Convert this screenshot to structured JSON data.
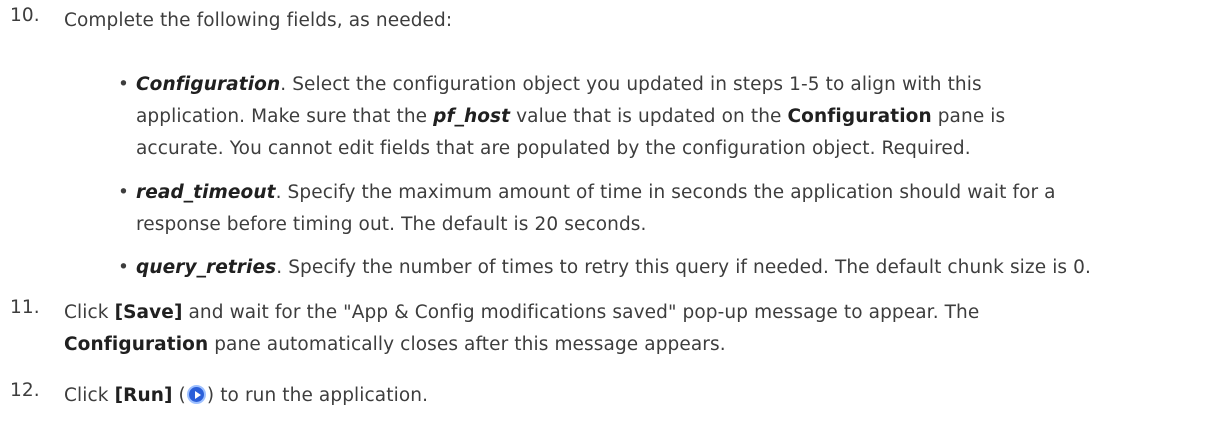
{
  "step10": {
    "number": "10.",
    "intro": "Complete the following fields, as needed:",
    "bullets": [
      {
        "term": "Configuration",
        "t1": ". Select the configuration object you updated in steps 1-5 to align with this",
        "t2": "application. Make sure that the ",
        "term2": "pf_host",
        "t3": " value that is updated on the ",
        "term3": "Configuration",
        "t4": " pane is",
        "t5": "accurate. You cannot edit fields that are populated by the configuration object. Required."
      },
      {
        "term": "read_timeout",
        "t1": ". Specify the maximum amount of time in seconds the application should wait for a",
        "t2": "response before timing out. The default is 20 seconds."
      },
      {
        "term": "query_retries",
        "t1": ". Specify the number of times to retry this query if needed. The default chunk size is 0."
      }
    ]
  },
  "step11": {
    "number": "11.",
    "t1": "Click ",
    "save_label": "[Save]",
    "t2": " and wait for the \"App & Config modifications saved\" pop-up message to appear. The",
    "term": "Configuration",
    "t3": " pane automatically closes after this message appears."
  },
  "step12": {
    "number": "12.",
    "t1": "Click ",
    "run_label": "[Run]",
    "t2": " (",
    "t3": ") to run the application.",
    "icon": "play-circle-icon"
  }
}
